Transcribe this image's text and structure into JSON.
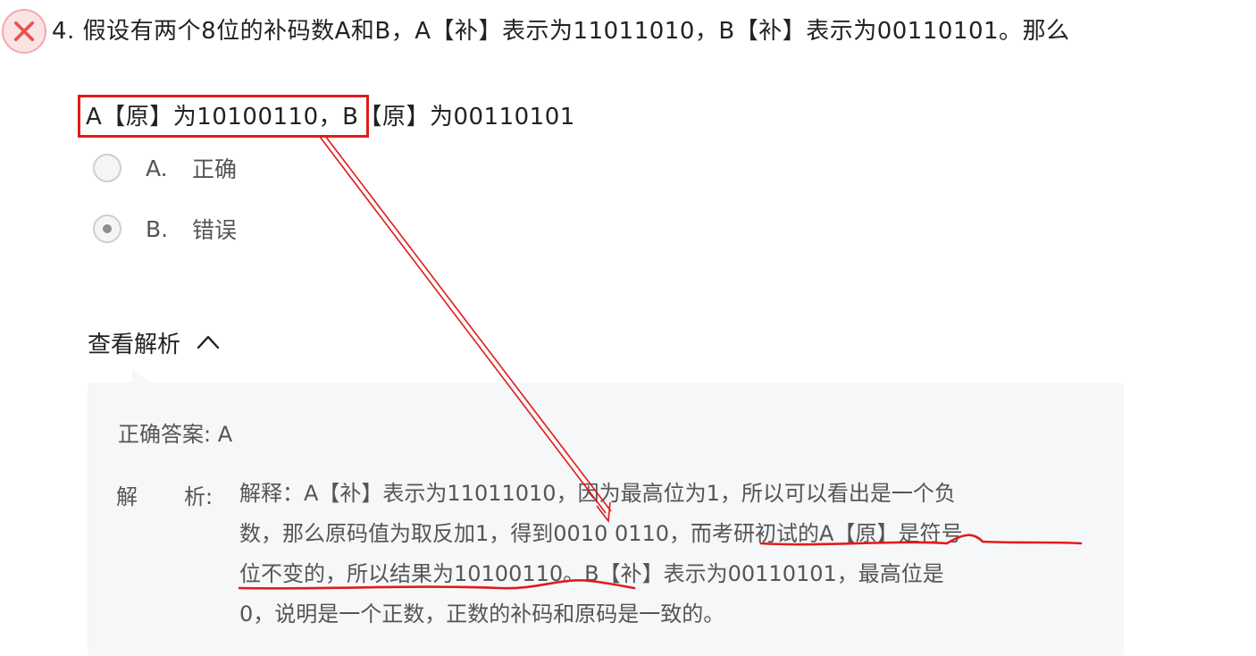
{
  "question": {
    "line1": "4. 假设有两个8位的补码数A和B，A【补】表示为11011010，B【补】表示为00110101。那么",
    "line2": "A【原】为10100110，B【原】为00110101"
  },
  "options": [
    {
      "letter": "A.",
      "text": "正确",
      "selected": false
    },
    {
      "letter": "B.",
      "text": "错误",
      "selected": true
    }
  ],
  "analysis": {
    "toggle_label": "查看解析",
    "answer_line": "正确答案: A",
    "label_left": "解",
    "label_right": "析:",
    "lines": [
      "解释：A【补】表示为11011010，因为最高位为1，所以可以看出是一个负",
      "数，那么原码值为取反加1，得到0010 0110，而考研初试的A【原】是符号",
      "位不变的，所以结果为10100110。B【补】表示为00110101，最高位是",
      "0，说明是一个正数，正数的补码和原码是一致的。"
    ]
  },
  "colors": {
    "annotation_red": "#e01b1b",
    "wrong_icon": "#e2564f"
  },
  "icons": {
    "status": "close-icon",
    "toggle": "chevron-up-icon"
  }
}
